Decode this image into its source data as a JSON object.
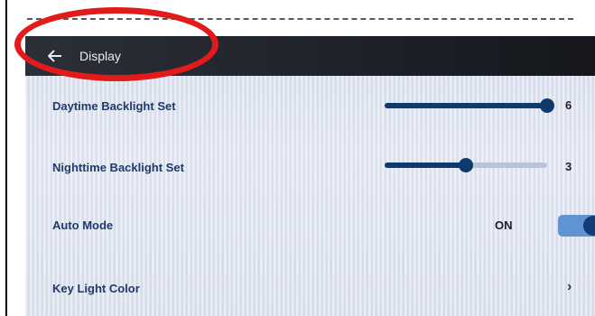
{
  "header": {
    "title": "Display",
    "back_icon": "arrow-left-icon"
  },
  "settings": [
    {
      "label": "Daytime Backlight Set",
      "value": "6",
      "level": 1.0
    },
    {
      "label": "Nighttime Backlight Set",
      "value": "3",
      "level": 0.5
    },
    {
      "label": "Auto Mode",
      "state_text": "ON"
    },
    {
      "label": "Key Light Color",
      "icon": "chevron-right-icon"
    }
  ],
  "colors": {
    "header_bg": "#1e2128",
    "accent": "#0e3a6e",
    "annotation": "#e11a1a"
  }
}
